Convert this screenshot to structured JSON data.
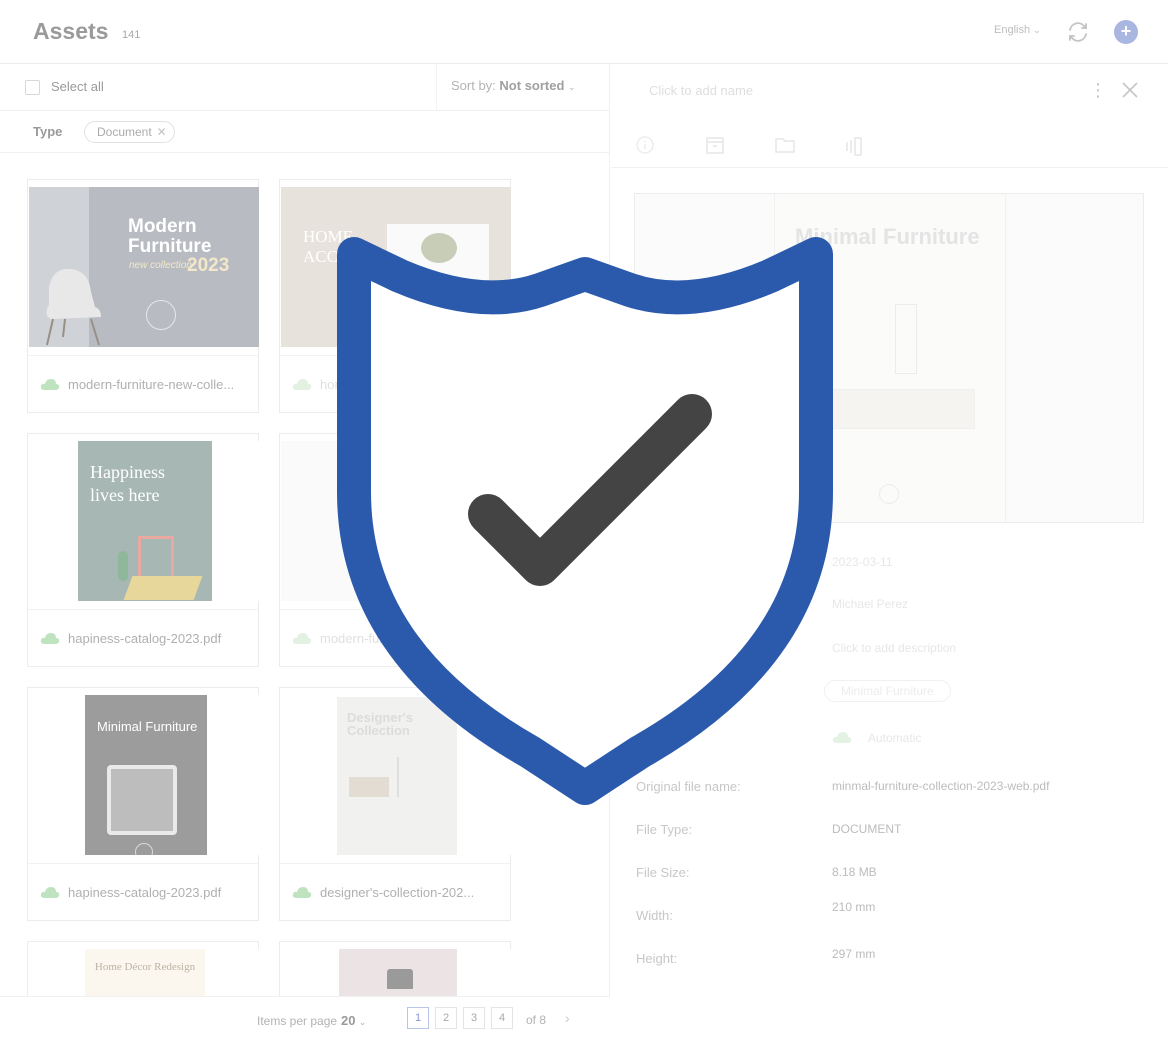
{
  "header": {
    "title": "Assets",
    "count": "141",
    "language": "English"
  },
  "toolbar": {
    "select_all": "Select all",
    "sort_prefix": "Sort by:",
    "sort_value": "Not sorted"
  },
  "filter": {
    "label": "Type",
    "chip": "Document"
  },
  "assets": [
    {
      "filename": "modern-furniture-new-colle...",
      "thumb_title": "Modern Furniture",
      "thumb_sub": "new collection",
      "thumb_year": "2023"
    },
    {
      "filename": "home-accents-collection...",
      "thumb_title": "HOME ACC"
    },
    {
      "filename": "hapiness-catalog-2023.pdf",
      "thumb_title": "Happiness lives here"
    },
    {
      "filename": "modern-furniture-new-colle...",
      "thumb_title": "Modern Furniture"
    },
    {
      "filename": "hapiness-catalog-2023.pdf",
      "thumb_title": "Minimal Furniture"
    },
    {
      "filename": "designer's-collection-202...",
      "thumb_title": "Designer's Collection"
    },
    {
      "filename": "",
      "thumb_title": "Home Décor Redesign"
    },
    {
      "filename": "",
      "thumb_title": ""
    }
  ],
  "pagination": {
    "items_per_page_label": "Items per page",
    "items_per_page": "20",
    "pages": [
      "1",
      "2",
      "3",
      "4"
    ],
    "of_pages": "of 8"
  },
  "detail": {
    "name_placeholder": "Click to add name",
    "preview_title": "Minimal Furniture",
    "date": "2023-03-11",
    "owner": "Michael Perez",
    "description_label": "Description:",
    "description_placeholder": "Click to add description",
    "labels_label": "Labels:",
    "label_tag": "Minimal Furniture",
    "sync_value": "Automatic",
    "original_name_label": "Original file name:",
    "original_name": "minmal-furniture-collection-2023-web.pdf",
    "file_type_label": "File Type:",
    "file_type": "DOCUMENT",
    "file_size_label": "File Size:",
    "file_size": "8.18 MB",
    "width_label": "Width:",
    "width": "210 mm",
    "height_label": "Height:",
    "height": "297 mm"
  },
  "colors": {
    "shield": "#2b5aac",
    "check": "#444444",
    "accent": "#a9b6e0",
    "cloud": "#9ed59e"
  }
}
